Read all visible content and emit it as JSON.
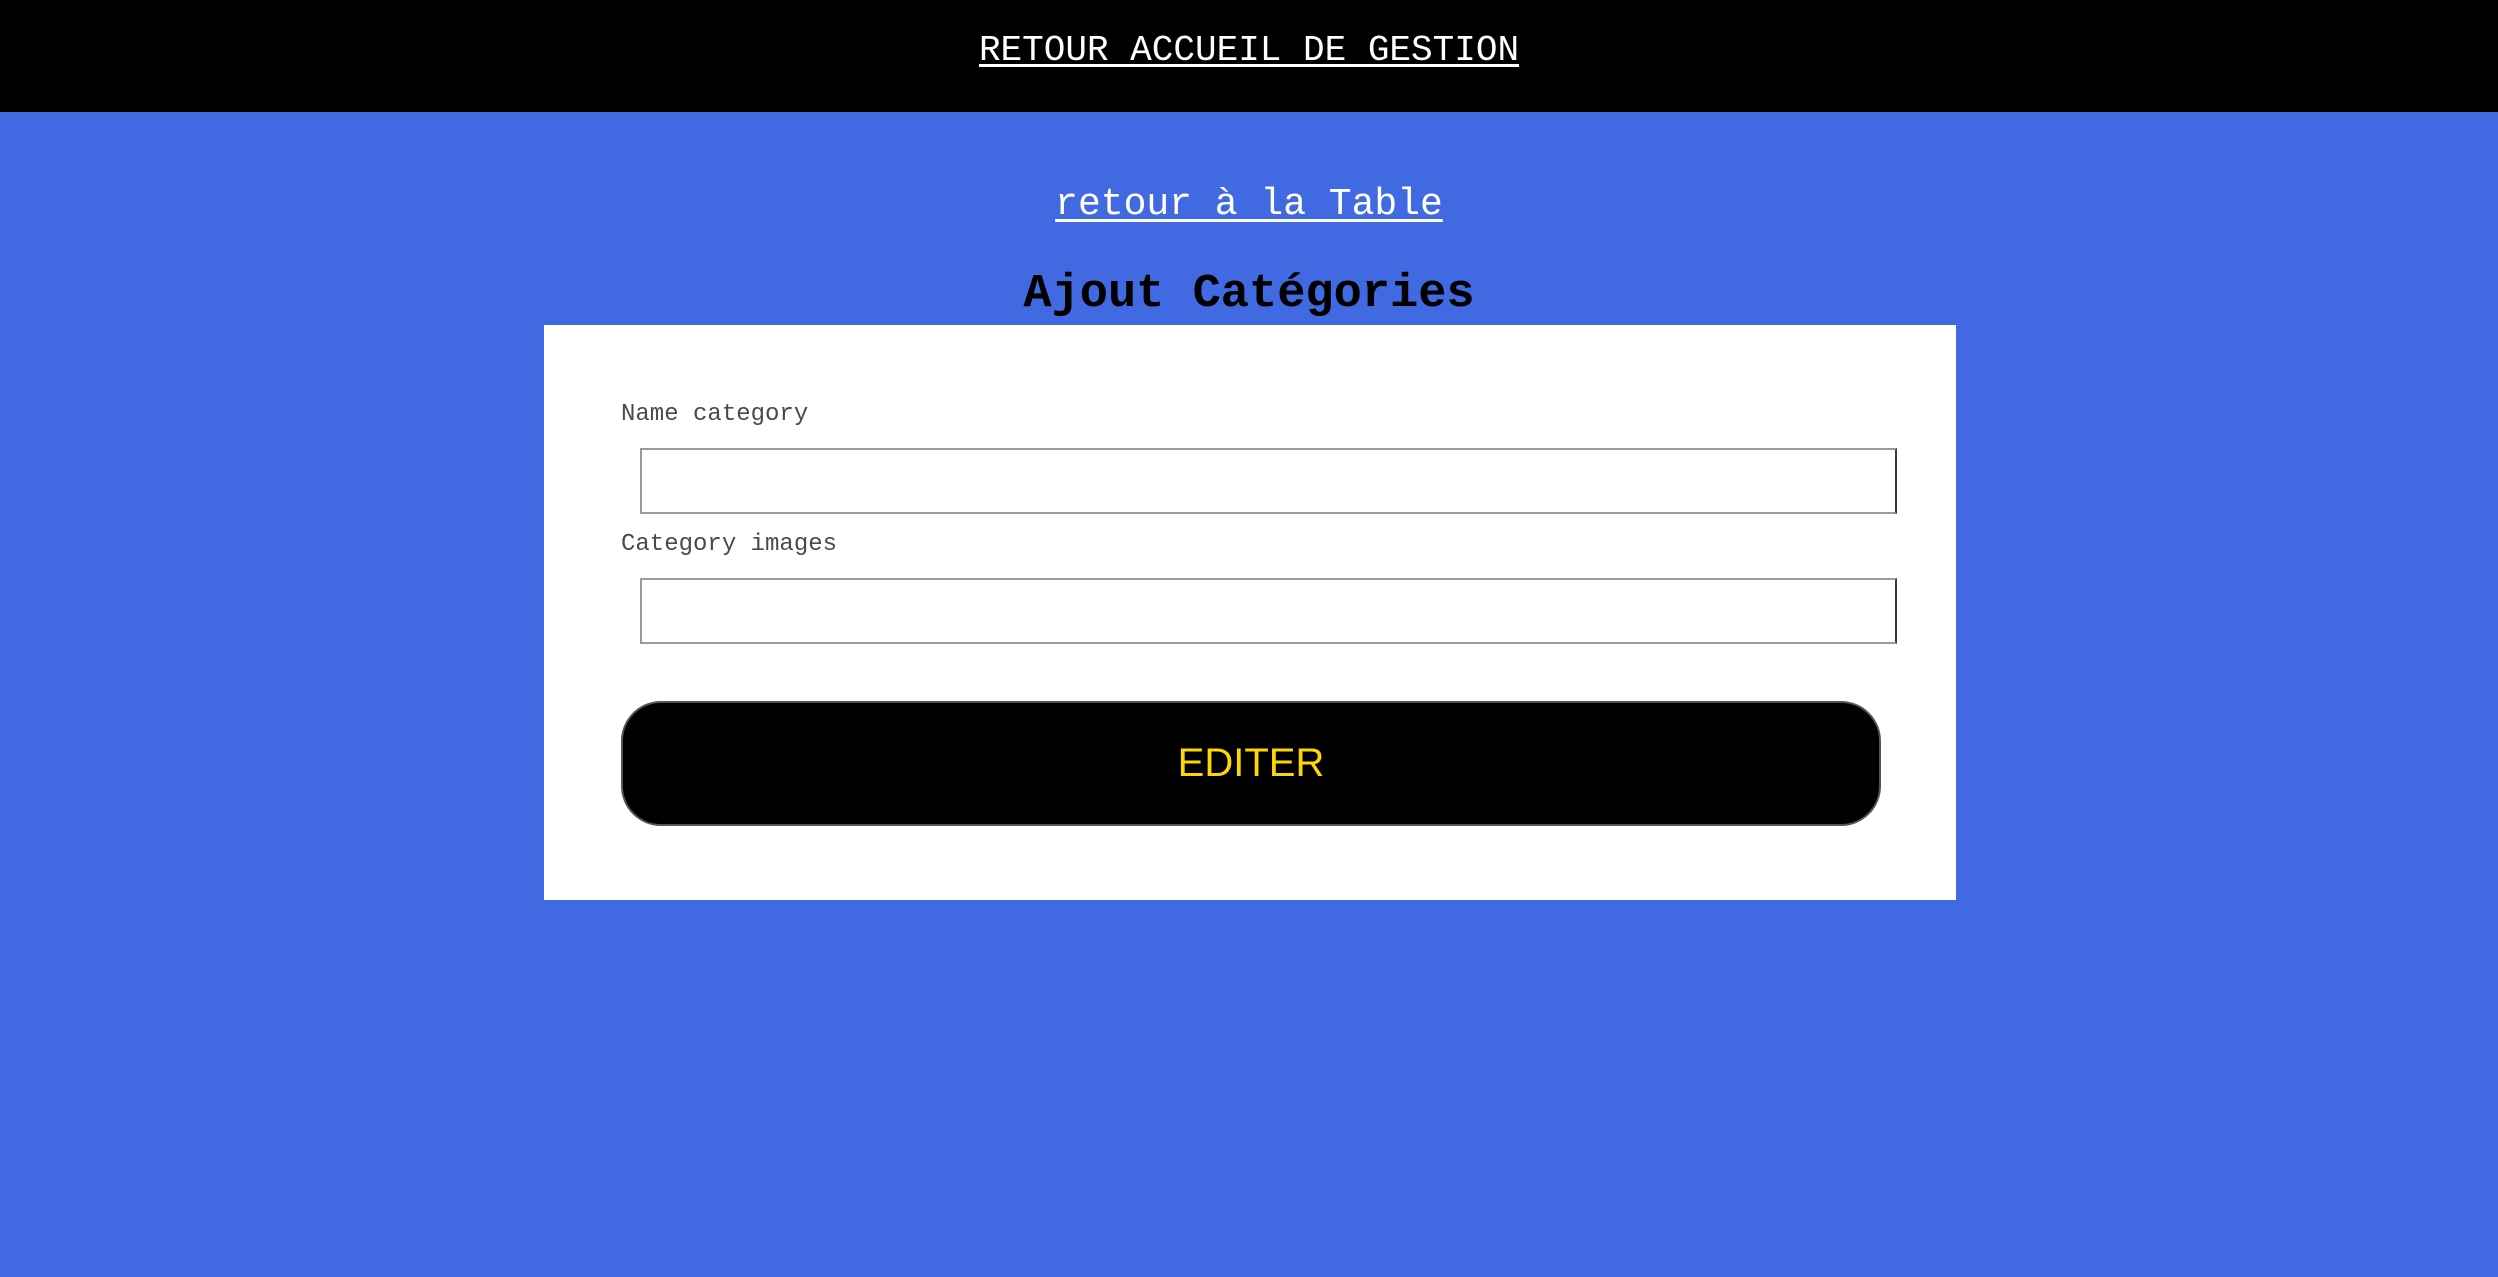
{
  "header": {
    "home_link": "RETOUR ACCUEIL DE GESTION"
  },
  "navigation": {
    "back_to_table": "retour à la Table"
  },
  "page": {
    "title": "Ajout Catégories"
  },
  "form": {
    "fields": [
      {
        "label": "Name category",
        "value": "",
        "placeholder": ""
      },
      {
        "label": "Category images",
        "value": "",
        "placeholder": ""
      }
    ],
    "submit_label": "EDITER"
  },
  "colors": {
    "background": "#4169e1",
    "header": "#000000",
    "button": "#000000",
    "button_text": "#ffd700"
  }
}
